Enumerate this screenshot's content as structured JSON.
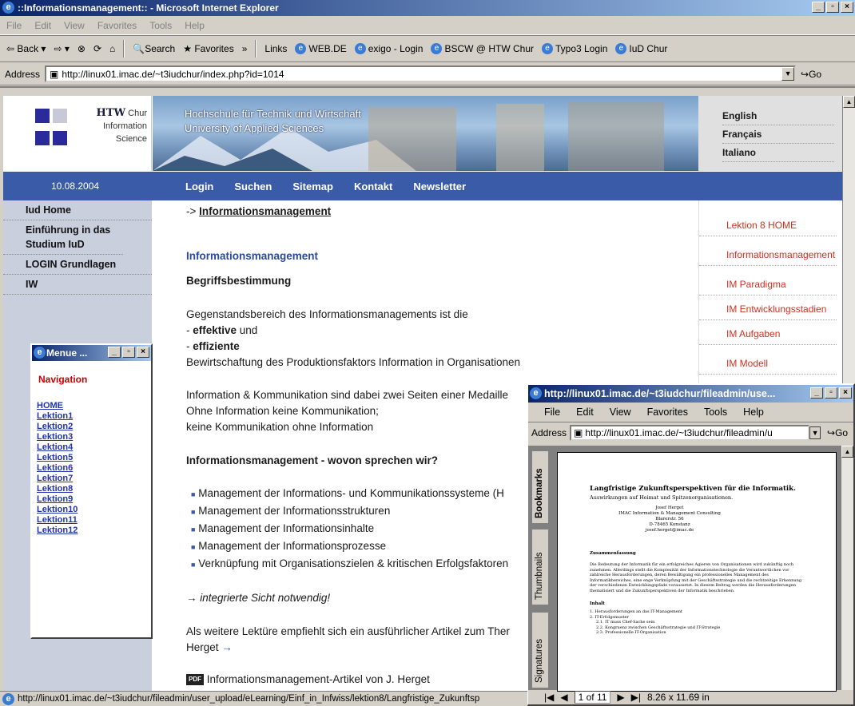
{
  "window": {
    "title": "::Informationsmanagement:: - Microsoft Internet Explorer",
    "menu": [
      "File",
      "Edit",
      "View",
      "Favorites",
      "Tools",
      "Help"
    ],
    "toolbar": {
      "back": "Back",
      "search": "Search",
      "favorites": "Favorites",
      "links_label": "Links",
      "links": [
        "WEB.DE",
        "exigo - Login",
        "BSCW @ HTW Chur",
        "Typo3 Login",
        "IuD Chur"
      ]
    },
    "address_label": "Address",
    "address": "http://linux01.imac.de/~t3iudchur/index.php?id=1014",
    "go_label": "Go",
    "status": "http://linux01.imac.de/~t3iudchur/fileadmin/user_upload/eLearning/Einf_in_Infwiss/lektion8/Langfristige_Zukunftsp"
  },
  "page": {
    "logo": {
      "name": "HTW",
      "place": "Chur",
      "line2": "Information",
      "line3": "Science"
    },
    "header_text": [
      "Hochschule für Technik und Wirtschaft",
      "University of Applied Sciences"
    ],
    "languages": [
      "English",
      "Français",
      "Italiano"
    ],
    "date": "10.08.2004",
    "nav": [
      "Login",
      "Suchen",
      "Sitemap",
      "Kontakt",
      "Newsletter"
    ],
    "left_nav": [
      "Iud Home",
      "Einführung in das Studium IuD",
      "LOGIN Grundlagen",
      "IW"
    ],
    "right_nav": [
      "Lektion 8 HOME",
      "Informationsmanagement",
      "IM Paradigma",
      "IM Entwicklungsstadien",
      "IM Aufgaben",
      "IM Modell"
    ],
    "breadcrumb_prefix": "->",
    "breadcrumb_link": "Informationsmanagement",
    "content": {
      "heading": "Informationsmanagement",
      "subheading": "Begriffsbestimmung",
      "p1": "Gegenstandsbereich des Informationsmanagements ist die",
      "effektive_bold": "effektive",
      "effektive_rest": " und",
      "dash": "- ",
      "effiziente": "effiziente",
      "p2": "Bewirtschaftung des Produktionsfaktors Information in Organisationen",
      "p3a": "Information & Kommunikation sind dabei zwei Seiten einer Medaille",
      "p3b": "Ohne Information keine Kommunikation;",
      "p3c": "keine Kommunikation ohne Information",
      "h2": "Informationsmanagement - wovon sprechen wir?",
      "bullets": [
        "Management der Informations- und Kommunikationssysteme (H",
        "Management der Informationsstrukturen",
        "Management der Informationsinhalte",
        "Management der Informationsprozesse",
        "Verknüpfung mit Organisationszielen & kritischen Erfolgsfaktoren"
      ],
      "arrow_text": "→ integrierte Sicht notwendig!",
      "p4a": "Als weitere Lektüre empfiehlt sich ein ausführlicher Artikel zum Ther",
      "p4b": "Herget",
      "p4_arrow": "→",
      "pdf_link": "Informationsmanagement-Artikel von J. Herget"
    }
  },
  "menue_window": {
    "title": "Menue ...",
    "heading": "Navigation",
    "links": [
      "HOME",
      "Lektion1",
      "Lektion2",
      "Lektion3",
      "Lektion4",
      "Lektion5",
      "Lektion6",
      "Lektion7",
      "Lektion8",
      "Lektion9",
      "Lektion10",
      "Lektion11",
      "Lektion12"
    ]
  },
  "popup": {
    "title": "http://linux01.imac.de/~t3iudchur/fileadmin/use...",
    "menu": [
      "File",
      "Edit",
      "View",
      "Favorites",
      "Tools",
      "Help"
    ],
    "address_label": "Address",
    "address": "http://linux01.imac.de/~t3iudchur/fileadmin/u",
    "go_label": "Go",
    "tabs": [
      "Bookmarks",
      "Thumbnails",
      "Signatures"
    ],
    "pdf": {
      "title": "Langfristige Zukunftsperspektiven für die Informatik.",
      "subtitle": "Auswirkungen auf Heimat und Spitzenorganisationen.",
      "author": [
        "Josef Herget",
        "IMAC Information & Management Consulting",
        "Blarerstr. 56",
        "D-78465 Konstanz",
        "josef.herget@imac.de"
      ],
      "section1": "Zusammenfassung",
      "abstract": "Die Bedeutung der Informatik für ein erfolgreiches Agieren von Organisationen wird zukünftig noch zunehmen. Allerdings stellt die Komplexität der Informationstechnologie die Verantwortlichen vor zahlreiche Herausforderungen, deren Bewältigung ein professionelles Management des Informatikbereiches, eine enge Verknüpfung mit der Geschäftsstrategie und die rechtzeitige Erkennung der verschiedenen Entwicklungspfade voraussetzt. In diesem Beitrag werden die Herausforderungen thematisiert und die Zukunftsperspektiven der Informatik beschrieben.",
      "section2": "Inhalt",
      "toc": [
        "1. Herausforderungen an das IT-Management",
        "2. IT-Erfolgsmuster",
        "2.1. IT muss Chef-Sache sein",
        "2.2. Kongruenz zwischen Geschäftsstrategie und IT-Strategie",
        "2.3. Professionelle IT-Organisation"
      ]
    },
    "page_indicator": "1 of 11",
    "page_size": "8.26 x 11.69 in"
  },
  "colors": {
    "nav_blue": "#3a5ca8",
    "left_gray": "#c9cfdd",
    "link_red": "#d03020",
    "title_blue": "#0a246a"
  }
}
